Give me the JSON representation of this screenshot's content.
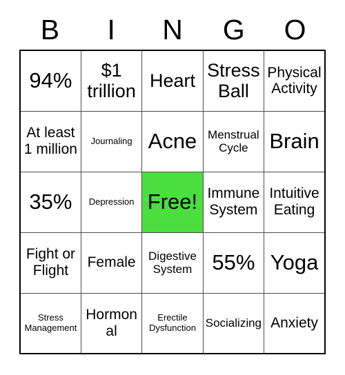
{
  "card": {
    "title": "BINGO",
    "header_letters": [
      "B",
      "I",
      "N",
      "G",
      "O"
    ],
    "free_space_color": "#4ade3e",
    "grid_line_color": "#4d4d4d",
    "border_color": "#000000",
    "text_color": "#000000",
    "rows": [
      [
        {
          "text": "94%",
          "size": "fs-xl",
          "free": false
        },
        {
          "text": "$1 trillion",
          "size": "fs-lg",
          "free": false
        },
        {
          "text": "Heart",
          "size": "fs-lg",
          "free": false
        },
        {
          "text": "Stress Ball",
          "size": "fs-lg",
          "free": false
        },
        {
          "text": "Physical Activity",
          "size": "fs-md",
          "free": false
        }
      ],
      [
        {
          "text": "At least 1 million",
          "size": "fs-md",
          "free": false
        },
        {
          "text": "Journaling",
          "size": "fs-xs",
          "free": false
        },
        {
          "text": "Acne",
          "size": "fs-xl",
          "free": false
        },
        {
          "text": "Menstrual Cycle",
          "size": "fs-sm",
          "free": false
        },
        {
          "text": "Brain",
          "size": "fs-xl",
          "free": false
        }
      ],
      [
        {
          "text": "35%",
          "size": "fs-xl",
          "free": false
        },
        {
          "text": "Depression",
          "size": "fs-xs",
          "free": false
        },
        {
          "text": "Free!",
          "size": "fs-xl",
          "free": true
        },
        {
          "text": "Immune System",
          "size": "fs-md",
          "free": false
        },
        {
          "text": "Intuitive Eating",
          "size": "fs-md",
          "free": false
        }
      ],
      [
        {
          "text": "Fight or Flight",
          "size": "fs-md",
          "free": false
        },
        {
          "text": "Female",
          "size": "fs-md",
          "free": false
        },
        {
          "text": "Digestive System",
          "size": "fs-sm",
          "free": false
        },
        {
          "text": "55%",
          "size": "fs-xl",
          "free": false
        },
        {
          "text": "Yoga",
          "size": "fs-xl",
          "free": false
        }
      ],
      [
        {
          "text": "Stress Management",
          "size": "fs-xs",
          "free": false
        },
        {
          "text": "Hormonal",
          "size": "fs-md",
          "free": false
        },
        {
          "text": "Erectile Dysfunction",
          "size": "fs-xs",
          "free": false
        },
        {
          "text": "Socializing",
          "size": "fs-sm",
          "free": false
        },
        {
          "text": "Anxiety",
          "size": "fs-md",
          "free": false
        }
      ]
    ]
  }
}
